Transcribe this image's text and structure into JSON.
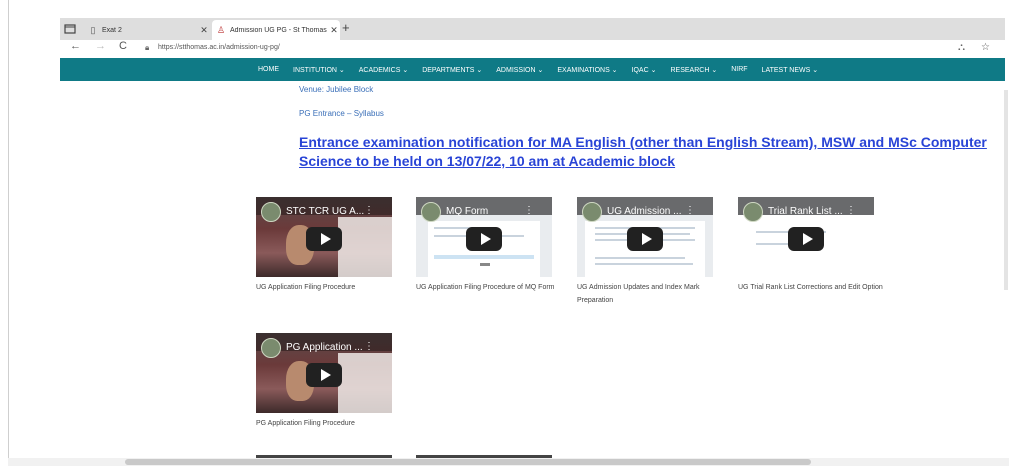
{
  "browser": {
    "tabs": [
      {
        "label": "Exat 2",
        "icon": "page-icon"
      },
      {
        "label": "Admission UG PG - St Thomas C",
        "icon": "site-favicon"
      }
    ],
    "new_tab": "+",
    "url": "https://stthomas.ac.in/admission-ug-pg/",
    "nav": {
      "back": "←",
      "forward": "→",
      "reload": "C"
    }
  },
  "sitenav": {
    "items": [
      "HOME",
      "INSTITUTION ⌄",
      "ACADEMICS ⌄",
      "DEPARTMENTS ⌄",
      "ADMISSION ⌄",
      "EXAMINATIONS ⌄",
      "IQAC ⌄",
      "RESEARCH ⌄",
      "NIRF",
      "LATEST NEWS ⌄"
    ]
  },
  "content": {
    "venue": "Venue: Jubilee Block",
    "pg_entrance": "PG Entrance – Syllabus",
    "notice": "Entrance examination notification for MA English (other than English Stream), MSW and MSc Computer Science to be held on 13/07/22, 10 am at Academic block",
    "videos": [
      {
        "title": "STC TCR UG A...",
        "caption": "UG Application Filing Procedure"
      },
      {
        "title": "MQ Form",
        "caption": "UG Application Filing Procedure of MQ Form"
      },
      {
        "title": "UG Admission ...",
        "caption": "UG Admission Updates and Index Mark Preparation"
      },
      {
        "title": "Trial Rank List ...",
        "caption": "UG Trial Rank List Corrections and Edit Option"
      },
      {
        "title": "PG Application ...",
        "caption": "PG Application Filing Procedure"
      }
    ]
  },
  "colors": {
    "nav_bg": "#0f7a86",
    "link": "#2944d6"
  }
}
